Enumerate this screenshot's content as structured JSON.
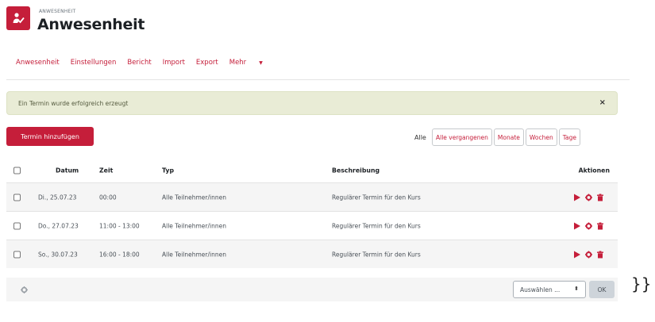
{
  "header": {
    "module_label": "ANWESENHEIT",
    "title": "Anwesenheit",
    "icon": "attendance-icon"
  },
  "nav": {
    "items": [
      "Anwesenheit",
      "Einstellungen",
      "Bericht",
      "Import",
      "Export"
    ],
    "more_label": "Mehr"
  },
  "alert": {
    "text": "Ein Termin wurde erfolgreich erzeugt",
    "close": "×"
  },
  "add_button": "Termin hinzufügen",
  "filters": {
    "label": "Alle",
    "buttons": [
      "Alle vergangenen",
      "Monate",
      "Wochen",
      "Tage"
    ]
  },
  "table": {
    "headers": {
      "datum": "Datum",
      "zeit": "Zeit",
      "typ": "Typ",
      "beschreibung": "Beschreibung",
      "aktionen": "Aktionen"
    },
    "rows": [
      {
        "datum": "Di., 25.07.23",
        "zeit": "00:00",
        "typ": "Alle Teilnehmer/innen",
        "beschreibung": "Regulärer Termin für den Kurs"
      },
      {
        "datum": "Do., 27.07.23",
        "zeit": "11:00 - 13:00",
        "typ": "Alle Teilnehmer/innen",
        "beschreibung": "Regulärer Termin für den Kurs"
      },
      {
        "datum": "So., 30.07.23",
        "zeit": "16:00 - 18:00",
        "typ": "Alle Teilnehmer/innen",
        "beschreibung": "Regulärer Termin für den Kurs"
      }
    ]
  },
  "footer": {
    "select_value": "Auswählen ...",
    "ok_label": "OK"
  },
  "trailing_text": "}}",
  "colors": {
    "accent": "#c51e3a",
    "alert_bg": "#e9ecd6"
  }
}
